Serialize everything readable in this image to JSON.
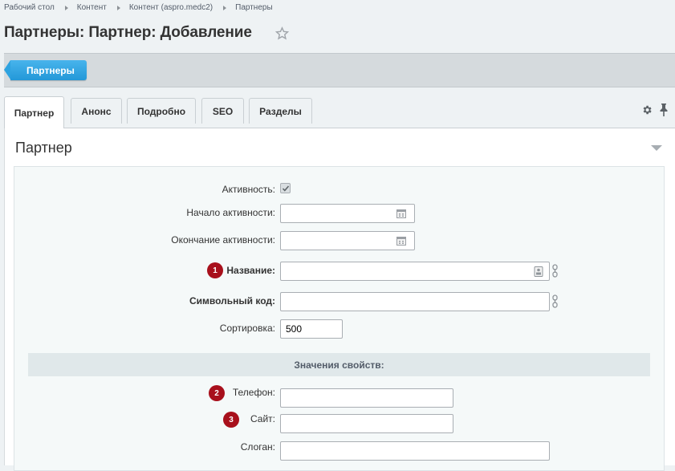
{
  "breadcrumb": [
    "Рабочий стол",
    "Контент",
    "Контент (aspro.medc2)",
    "Партнеры"
  ],
  "page": {
    "title": "Партнеры: Партнер: Добавление"
  },
  "toolbar": {
    "back_label": "Партнеры"
  },
  "tabs": [
    {
      "label": "Партнер",
      "active": true
    },
    {
      "label": "Анонс"
    },
    {
      "label": "Подробно"
    },
    {
      "label": "SEO"
    },
    {
      "label": "Разделы"
    }
  ],
  "section": {
    "title": "Партнер"
  },
  "form": {
    "active_label": "Активность:",
    "active_checked": true,
    "start_label": "Начало активности:",
    "start_value": "",
    "end_label": "Окончание активности:",
    "end_value": "",
    "name_label": "Название:",
    "name_value": "",
    "name_badge": "1",
    "code_label": "Символьный код:",
    "code_value": "",
    "sort_label": "Сортировка:",
    "sort_value": "500"
  },
  "properties": {
    "header": "Значения свойств:",
    "phone_label": "Телефон:",
    "phone_value": "",
    "phone_badge": "2",
    "site_label": "Сайт:",
    "site_value": "",
    "site_badge": "3",
    "slogan_label": "Слоган:",
    "slogan_value": ""
  },
  "colors": {
    "accent": "#2398d8",
    "badge": "#a8101c",
    "background": "#eef2f4"
  },
  "icons": [
    "star-icon",
    "gear-icon",
    "pin-icon",
    "calendar-icon",
    "language-icon",
    "link-icon",
    "checkmark-icon",
    "collapse-arrow-icon"
  ]
}
